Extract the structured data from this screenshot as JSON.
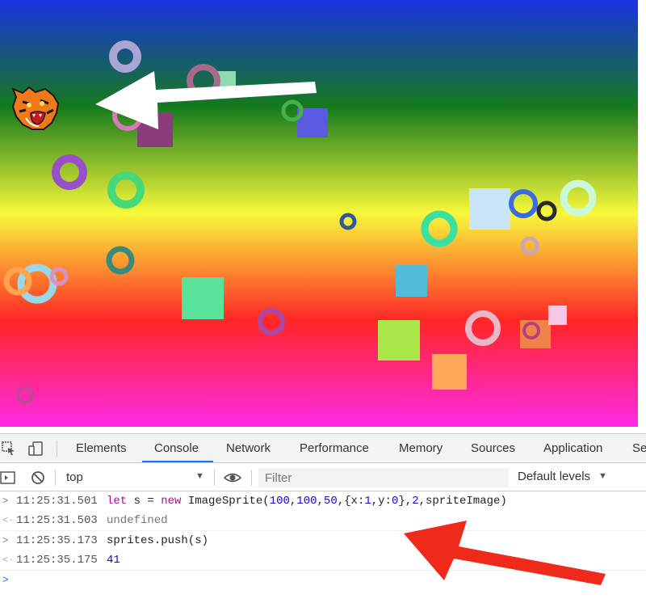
{
  "canvas": {
    "gradient": [
      "#1a32e0",
      "#1a8a1a",
      "#f8f83a",
      "#ff2a2a",
      "#ff2ad8"
    ],
    "sprite": "tiger-head-icon",
    "annotation_arrows": [
      "white-arrow",
      "red-arrow"
    ]
  },
  "devtools": {
    "tabs": [
      "Elements",
      "Console",
      "Network",
      "Performance",
      "Memory",
      "Sources",
      "Application",
      "Se"
    ],
    "active_tab": "Console",
    "toolbar": {
      "context": "top",
      "filter_placeholder": "Filter",
      "levels": "Default levels"
    },
    "console": [
      {
        "time": "11:25:31.501",
        "kind": "input",
        "code": "let s = new ImageSprite(100,100,50,{x:1,y:0},2,spriteImage)"
      },
      {
        "time": "11:25:31.503",
        "kind": "result",
        "value": "undefined"
      },
      {
        "time": "11:25:35.173",
        "kind": "input",
        "code": "sprites.push(s)"
      },
      {
        "time": "11:25:35.175",
        "kind": "result",
        "value": "41"
      }
    ]
  },
  "colors": {
    "accent": "#1a73e8",
    "arrow_red": "#f02a1a",
    "arrow_white": "#ffffff"
  }
}
